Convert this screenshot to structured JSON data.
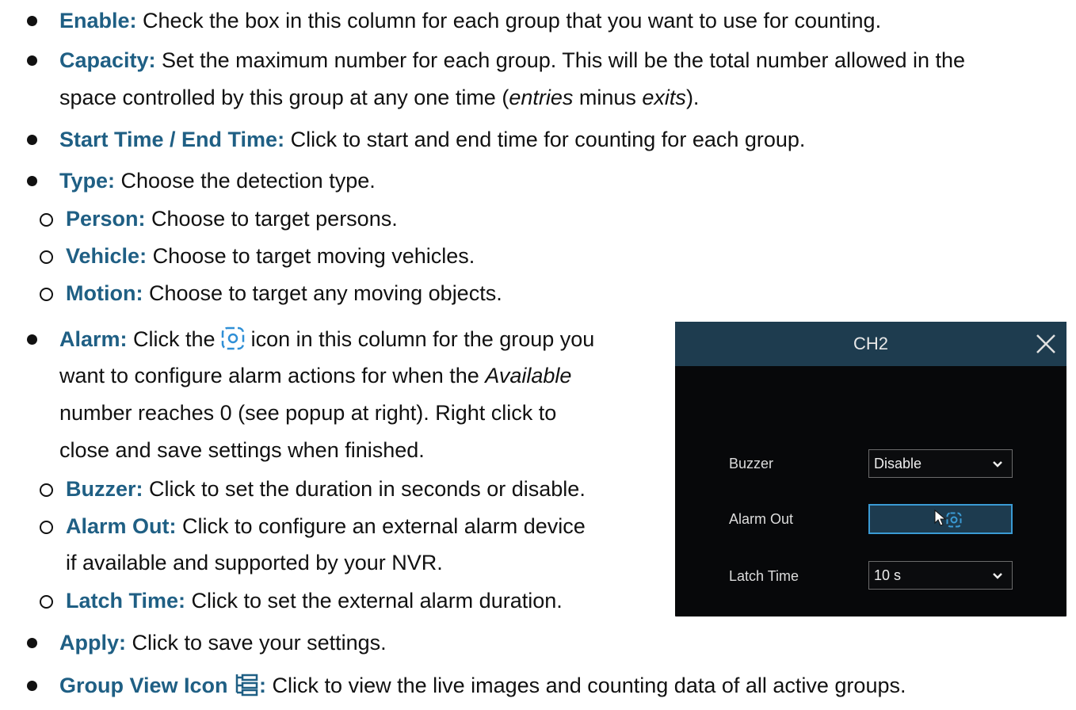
{
  "bullets": {
    "enable": {
      "term": "Enable:",
      "text": " Check the box in this column for each group that you want to use for counting."
    },
    "capacity": {
      "term": "Capacity:",
      "text": " Set the maximum number for each group. This will be the total number allowed in the",
      "text2": "space controlled by this group at any one time (",
      "entries": "entries",
      "minus": " minus ",
      "exits": "exits",
      "close": ")."
    },
    "time": {
      "term": "Start Time / End Time:",
      "text": " Click to start and end time for counting for each group."
    },
    "type": {
      "term": "Type:",
      "text": " Choose the detection type."
    },
    "person": {
      "term": "Person:",
      "text": " Choose to target persons."
    },
    "vehicle": {
      "term": "Vehicle:",
      "text": " Choose to target moving vehicles."
    },
    "motion": {
      "term": "Motion:",
      "text": " Choose to target any moving objects."
    },
    "alarm": {
      "term": "Alarm:",
      "text_a": " Click the ",
      "text_b": " icon in this column for the group you",
      "line2a": "want to configure alarm actions for when the ",
      "available": "Available",
      "line3": "number reaches 0 (see popup at right). Right click to",
      "line4": "close and save settings when finished."
    },
    "buzzer": {
      "term": "Buzzer:",
      "text": " Click to set the duration in seconds or disable."
    },
    "alarm_out": {
      "term": "Alarm Out:",
      "text": " Click to configure an external alarm device",
      "line2": "if available and supported by your NVR."
    },
    "latch": {
      "term": "Latch Time:",
      "text": " Click to set the external alarm duration."
    },
    "apply": {
      "term": "Apply:",
      "text": " Click to save your settings."
    },
    "group_view": {
      "term": "Group View Icon ",
      "colon": ":",
      "text": " Click to view the live images and counting data of all active groups."
    }
  },
  "popup": {
    "title": "CH2",
    "buzzer_label": "Buzzer",
    "buzzer_value": "Disable",
    "alarm_out_label": "Alarm Out",
    "latch_label": "Latch Time",
    "latch_value": "10 s"
  },
  "colors": {
    "term": "#1f5f84",
    "accent": "#3a9ad4",
    "header": "#1e3c4f"
  }
}
